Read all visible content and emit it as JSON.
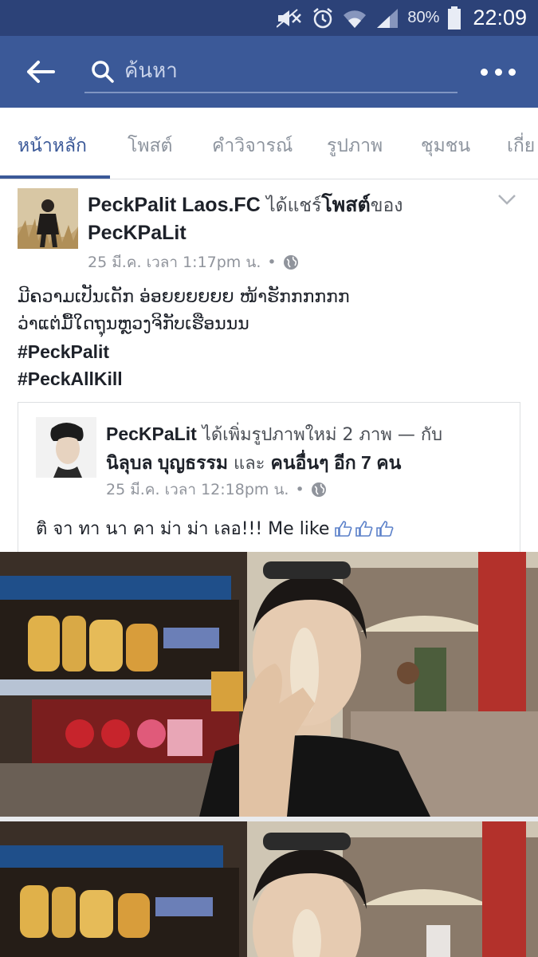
{
  "status_bar": {
    "battery": "80%",
    "time": "22:09",
    "icons": [
      "mute-icon",
      "alarm-icon",
      "wifi-icon",
      "signal-icon",
      "battery-icon"
    ]
  },
  "top_bar": {
    "search_placeholder": "ค้นหา",
    "icons": [
      "back-arrow-icon",
      "search-icon",
      "more-icon"
    ]
  },
  "tabs": [
    {
      "label": "หน้าหลัก",
      "active": true
    },
    {
      "label": "โพสต์",
      "active": false
    },
    {
      "label": "คำวิจารณ์",
      "active": false
    },
    {
      "label": "รูปภาพ",
      "active": false
    },
    {
      "label": "ชุมชน",
      "active": false
    },
    {
      "label": "เกี่ย",
      "active": false
    }
  ],
  "post": {
    "page_name": "PeckPalit Laos.FC",
    "shared_text": "ได้แชร์",
    "post_word": "โพสต์",
    "of_text": "ของ",
    "original_author": "PecKPaLit",
    "timestamp": "25 มี.ค. เวลา 1:17pm น.",
    "separator": "•",
    "body_line1": "ມີຄວາມເປັນເດັກ ອ່ອຍຍຍຍຍຍ ໜ້າຮັກກກກກກ",
    "body_line2": "ວ່າແຕ່ມື້ໃດຖຸນຫຼວງຈິກັບເຮືອນນນ",
    "hashtags": [
      "#PeckPalit",
      "#PeckAllKill"
    ]
  },
  "shared_post": {
    "author": "PecKPaLit",
    "added_text": "ได้เพิ่มรูปภาพใหม่ 2 ภาพ — กับ",
    "tagged_person": "นิลุบล บุญธรรม",
    "and_text": "และ",
    "others": "คนอื่นๆ อีก 7 คน",
    "timestamp": "25 มี.ค. เวลา 12:18pm น.",
    "separator": "•",
    "text": "ติ จา ทา นา คา ม่า ม่า เลอ!!!  Me like",
    "emoji": [
      "thumbs-up-icon",
      "thumbs-up-icon",
      "thumbs-up-icon"
    ]
  },
  "colors": {
    "status_bar": "#2c4278",
    "top_bar": "#3b5998",
    "accent": "#3b5998",
    "muted_text": "#90949c"
  }
}
